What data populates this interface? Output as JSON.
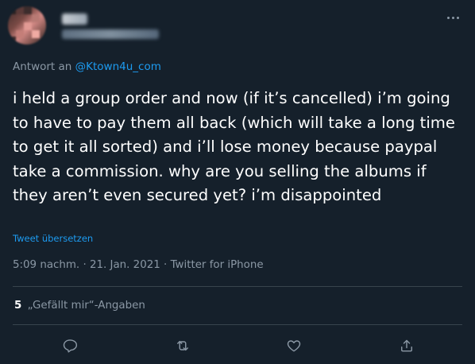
{
  "reply": {
    "prefix": "Antwort an",
    "handle": "@Ktown4u_com"
  },
  "tweet": {
    "text": "i held a group order and now (if it’s cancelled) i’m going to have to pay them all back (which will take a long time to get it all sorted) and i’ll lose money because paypal take a commission. why are you selling the albums if they aren’t even secured yet? i’m disappointed",
    "translate_label": "Tweet übersetzen",
    "time": "5:09 nachm.",
    "date": "21. Jan. 2021",
    "source": "Twitter for iPhone",
    "separator": "·"
  },
  "stats": {
    "likes_count": "5",
    "likes_label": "„Gefällt mir“-Angaben"
  },
  "icons": {
    "more": "more-horizontal-icon",
    "reply": "reply-bubble-icon",
    "retweet": "retweet-icon",
    "like": "heart-icon",
    "share": "share-icon"
  },
  "colors": {
    "background": "#15202b",
    "text": "#ffffff",
    "secondary": "#8b98a5",
    "accent": "#1d9bf0",
    "divider": "#38444d"
  }
}
